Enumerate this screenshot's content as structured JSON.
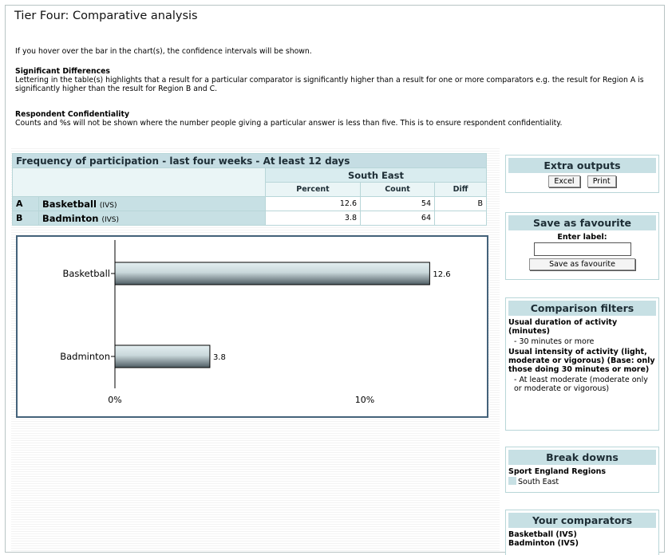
{
  "page": {
    "title": "Tier Four: Comparative analysis",
    "hover_note": "If you hover over the bar in the chart(s), the confidence intervals will be shown.",
    "sig_heading": "Significant Differences",
    "sig_text": "Lettering in the table(s) highlights that a result for a particular comparator is significantly higher than a result for one or more comparators e.g. the result for Region A is significantly higher than the result for Region B and C.",
    "conf_heading": "Respondent Confidentiality",
    "conf_text": "Counts and %s will not be shown where the number people giving a particular answer is less than five. This is to ensure respondent confidentiality."
  },
  "table": {
    "title": "Frequency of participation - last four weeks - At least 12 days",
    "region": "South East",
    "columns": [
      "Percent",
      "Count",
      "Diff"
    ],
    "rows": [
      {
        "letter": "A",
        "name": "Basketball",
        "tag": "(IVS)",
        "percent": "12.6",
        "count": "54",
        "diff": "B"
      },
      {
        "letter": "B",
        "name": "Badminton",
        "tag": "(IVS)",
        "percent": "3.8",
        "count": "64",
        "diff": ""
      }
    ]
  },
  "chart_data": {
    "type": "bar",
    "orientation": "horizontal",
    "categories": [
      "Basketball",
      "Badminton"
    ],
    "values": [
      12.6,
      3.8
    ],
    "value_labels": [
      "12.6",
      "3.8"
    ],
    "x_ticks": [
      "0%",
      "10%"
    ],
    "xlim": [
      0,
      15
    ],
    "grid": false,
    "colors": {
      "bar_light": "#d4e3e6",
      "bar_dark": "#56646a"
    }
  },
  "extra_outputs": {
    "title": "Extra outputs",
    "excel": "Excel",
    "print": "Print"
  },
  "favourite": {
    "title": "Save as favourite",
    "label": "Enter label:",
    "input_value": "",
    "button": "Save as favourite"
  },
  "filters": {
    "title": "Comparison filters",
    "items": [
      {
        "heading": "Usual duration of activity (minutes)",
        "value": "- 30 minutes or more"
      },
      {
        "heading": "Usual intensity of activity (light, moderate or vigorous) (Base: only those doing 30 minutes or more)",
        "value": "- At least moderate (moderate only or moderate or vigorous)"
      }
    ]
  },
  "breakdowns": {
    "title": "Break downs",
    "group": "Sport England Regions",
    "item": "South East"
  },
  "comparators": {
    "title": "Your comparators",
    "items": [
      "Basketball (IVS)",
      "Badminton (IVS)"
    ]
  }
}
